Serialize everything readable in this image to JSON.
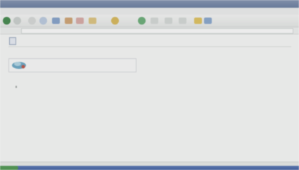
{
  "window": {
    "title": ""
  },
  "menu": [],
  "toolbar": {
    "buttons": [
      {
        "name": "back-icon",
        "color": "#2f8a3c"
      },
      {
        "name": "forward-icon",
        "color": "#9aa3a0"
      },
      {
        "name": "stop-icon",
        "color": "#c8ccca"
      },
      {
        "name": "refresh-icon",
        "color": "#7aa1d6"
      },
      {
        "name": "home-icon",
        "color": "#5e86c4"
      },
      {
        "name": "search-icon",
        "color": "#d38a3c"
      },
      {
        "name": "favorites-icon",
        "color": "#e0b83c"
      },
      {
        "name": "media-icon",
        "color": "#3ca06a"
      },
      {
        "name": "history-icon",
        "color": "#c9d0cd"
      },
      {
        "name": "mail-icon",
        "color": "#c9d0cd"
      },
      {
        "name": "print-icon",
        "color": "#c9d0cd"
      },
      {
        "name": "folder-icon",
        "color": "#e8c240"
      }
    ]
  },
  "address": {
    "label": "",
    "url": ""
  },
  "page": {
    "title": "",
    "intro": "",
    "note": "",
    "section_heading": "",
    "bullets": [
      "",
      "",
      "",
      "",
      "",
      "",
      "",
      "",
      "",
      "",
      "",
      "",
      "",
      "",
      ""
    ],
    "footer_link": ""
  },
  "status": {
    "text": ""
  },
  "colors": {
    "taskbar": "#2f58b0",
    "start": "#3b9a3e",
    "link": "#6c7b9a"
  }
}
